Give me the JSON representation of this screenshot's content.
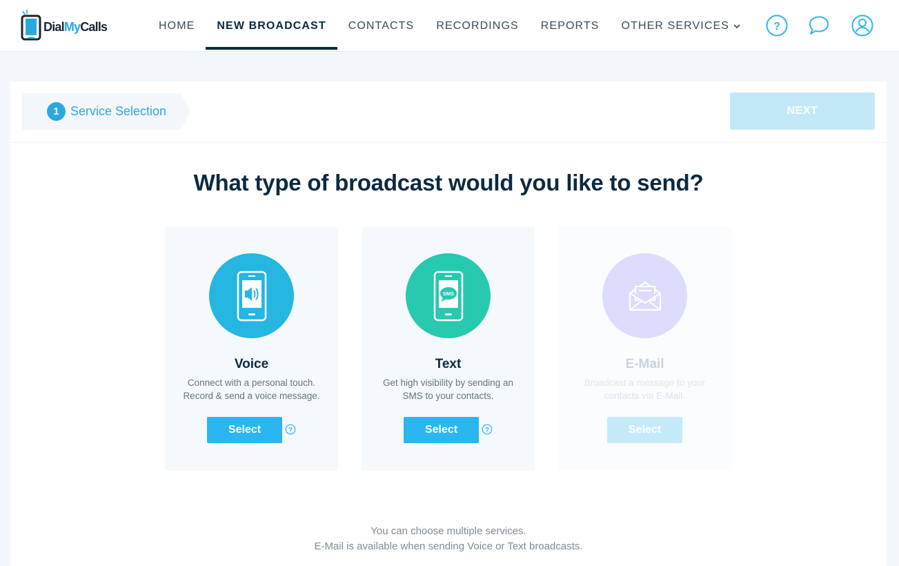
{
  "header": {
    "logo": {
      "part1": "Dial",
      "part2": "My",
      "part3": "Calls"
    },
    "nav": [
      {
        "label": "HOME",
        "active": false
      },
      {
        "label": "NEW BROADCAST",
        "active": true
      },
      {
        "label": "CONTACTS",
        "active": false
      },
      {
        "label": "RECORDINGS",
        "active": false
      },
      {
        "label": "REPORTS",
        "active": false
      },
      {
        "label": "OTHER SERVICES",
        "active": false,
        "has_dropdown": true
      }
    ],
    "icons": [
      "help-icon",
      "chat-icon",
      "user-account-icon"
    ],
    "accent_color": "#2aa8e0"
  },
  "steps": {
    "current": {
      "number": "1",
      "label": "Service Selection"
    },
    "next_label": "NEXT"
  },
  "main": {
    "question": "What type of broadcast would you like to send?",
    "services": [
      {
        "title": "Voice",
        "desc_line1": "Connect with a personal touch.",
        "desc_line2": "Record & send a voice message.",
        "button": "Select",
        "icon": "phone-speaker-icon",
        "color": "#25b6e2",
        "enabled": true
      },
      {
        "title": "Text",
        "desc_line1": "Get high visibility by sending an",
        "desc_line2": "SMS to your contacts.",
        "button": "Select",
        "icon": "phone-sms-icon",
        "color": "#27c9af",
        "enabled": true
      },
      {
        "title": "E-Mail",
        "desc_line1": "Broadcast a message to your",
        "desc_line2": "contacts via E-Mail.",
        "button": "Select",
        "icon": "envelope-icon",
        "color": "#dcdcfd",
        "enabled": false
      }
    ],
    "note_line1": "You can choose multiple services.",
    "note_line2": "E-Mail is available when sending Voice or Text broadcasts."
  }
}
